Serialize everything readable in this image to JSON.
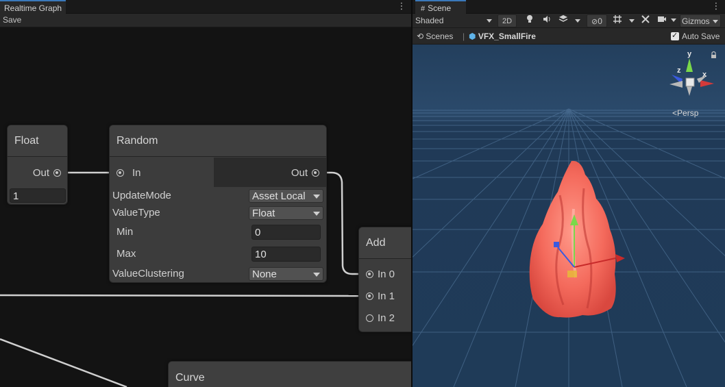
{
  "graph": {
    "tab_title": "Realtime Graph",
    "save_label": "Save",
    "nodes": {
      "float": {
        "title": "Float",
        "out_label": "Out",
        "value": "1"
      },
      "random": {
        "title": "Random",
        "in_label": "In",
        "out_label": "Out",
        "update_mode_label": "UpdateMode",
        "update_mode_value": "Asset Local",
        "value_type_label": "ValueType",
        "value_type_value": "Float",
        "min_label": "Min",
        "min_value": "0",
        "max_label": "Max",
        "max_value": "10",
        "value_clustering_label": "ValueClustering",
        "value_clustering_value": "None"
      },
      "add": {
        "title": "Add",
        "in0_label": "In 0",
        "in1_label": "In 1",
        "in2_label": "In 2"
      },
      "curve": {
        "title": "Curve"
      }
    }
  },
  "scene": {
    "tab_title": "Scene",
    "shading_mode": "Shaded",
    "mode_2d": "2D",
    "hidden_count": "0",
    "gizmos_label": "Gizmos",
    "breadcrumb_root": "Scenes",
    "breadcrumb_asset": "VFX_SmallFire",
    "auto_save_label": "Auto Save",
    "projection_label": "Persp",
    "axis_labels": {
      "x": "x",
      "y": "y",
      "z": "z"
    },
    "colors": {
      "sky": "#223e5c",
      "fire": "#ff6a5c",
      "accent": "#3a79bb"
    }
  }
}
